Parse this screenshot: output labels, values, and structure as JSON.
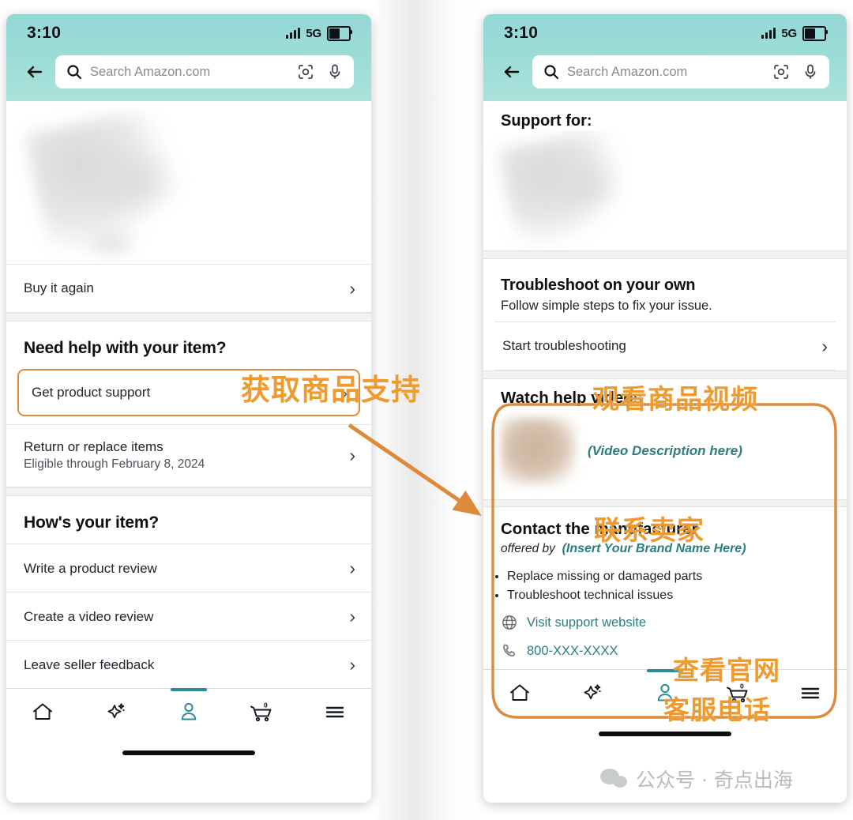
{
  "status": {
    "time": "3:10",
    "network": "5G",
    "signal_icon": "signal-bars-icon",
    "battery_icon": "battery-icon"
  },
  "search": {
    "placeholder": "Search Amazon.com",
    "back_icon": "back-arrow-icon",
    "search_icon": "search-icon",
    "camera_icon": "camera-lens-icon",
    "mic_icon": "microphone-icon"
  },
  "colors": {
    "header_teal": "#9bdcd6",
    "annotation_orange": "#ee9a2e",
    "highlight_orange": "#dd8a3c",
    "link_teal": "#2d7d7d",
    "active_tab": "#2b8a94"
  },
  "left_phone": {
    "product_image_alt": "blurred product photo",
    "buy_again": {
      "label": "Buy it again"
    },
    "need_help": {
      "heading": "Need help with your item?",
      "rows": [
        {
          "title": "Get product support",
          "subtitle": "",
          "highlighted": true
        },
        {
          "title": "Return or replace items",
          "subtitle": "Eligible through February 8, 2024",
          "highlighted": false
        }
      ]
    },
    "hows_your_item": {
      "heading": "How's your item?",
      "rows": [
        {
          "title": "Write a product review"
        },
        {
          "title": "Create a video review"
        },
        {
          "title": "Leave seller feedback"
        }
      ]
    }
  },
  "right_phone": {
    "support_for": "Support for:",
    "product_image_alt": "blurred product photo",
    "troubleshoot": {
      "heading": "Troubleshoot on your own",
      "subheading": "Follow simple steps to fix your issue.",
      "row": {
        "title": "Start troubleshooting"
      }
    },
    "watch_videos": {
      "heading": "Watch help videos",
      "video_description": "(Video Description here)",
      "thumbnail_alt": "blurred video thumbnail"
    },
    "contact_manufacturer": {
      "heading": "Contact the manufacturer",
      "offered_by_label": "offered by",
      "brand_name": "(Insert Your Brand Name Here)",
      "bullets": [
        "Replace missing or damaged parts",
        "Troubleshoot technical issues"
      ],
      "website_link": "Visit support website",
      "website_icon": "globe-icon",
      "phone_link": "800-XXX-XXXX",
      "phone_icon": "phone-handset-icon"
    }
  },
  "tabbar": {
    "items": [
      {
        "name": "home",
        "icon": "home-icon",
        "active": false
      },
      {
        "name": "discover",
        "icon": "sparkle-icon",
        "active": false
      },
      {
        "name": "account",
        "icon": "person-icon",
        "active": true
      },
      {
        "name": "cart",
        "icon": "cart-icon",
        "badge": "0",
        "active": false
      },
      {
        "name": "menu",
        "icon": "hamburger-menu-icon",
        "active": false
      }
    ]
  },
  "annotations": {
    "get_product_support": "获取商品支持",
    "watch_product_video": "观看商品视频",
    "contact_seller": "联系卖家",
    "visit_official_site": "查看官网",
    "customer_service_phone": "客服电话"
  },
  "watermark": {
    "text": "公众号 · 奇点出海",
    "icon": "wechat-icon"
  }
}
